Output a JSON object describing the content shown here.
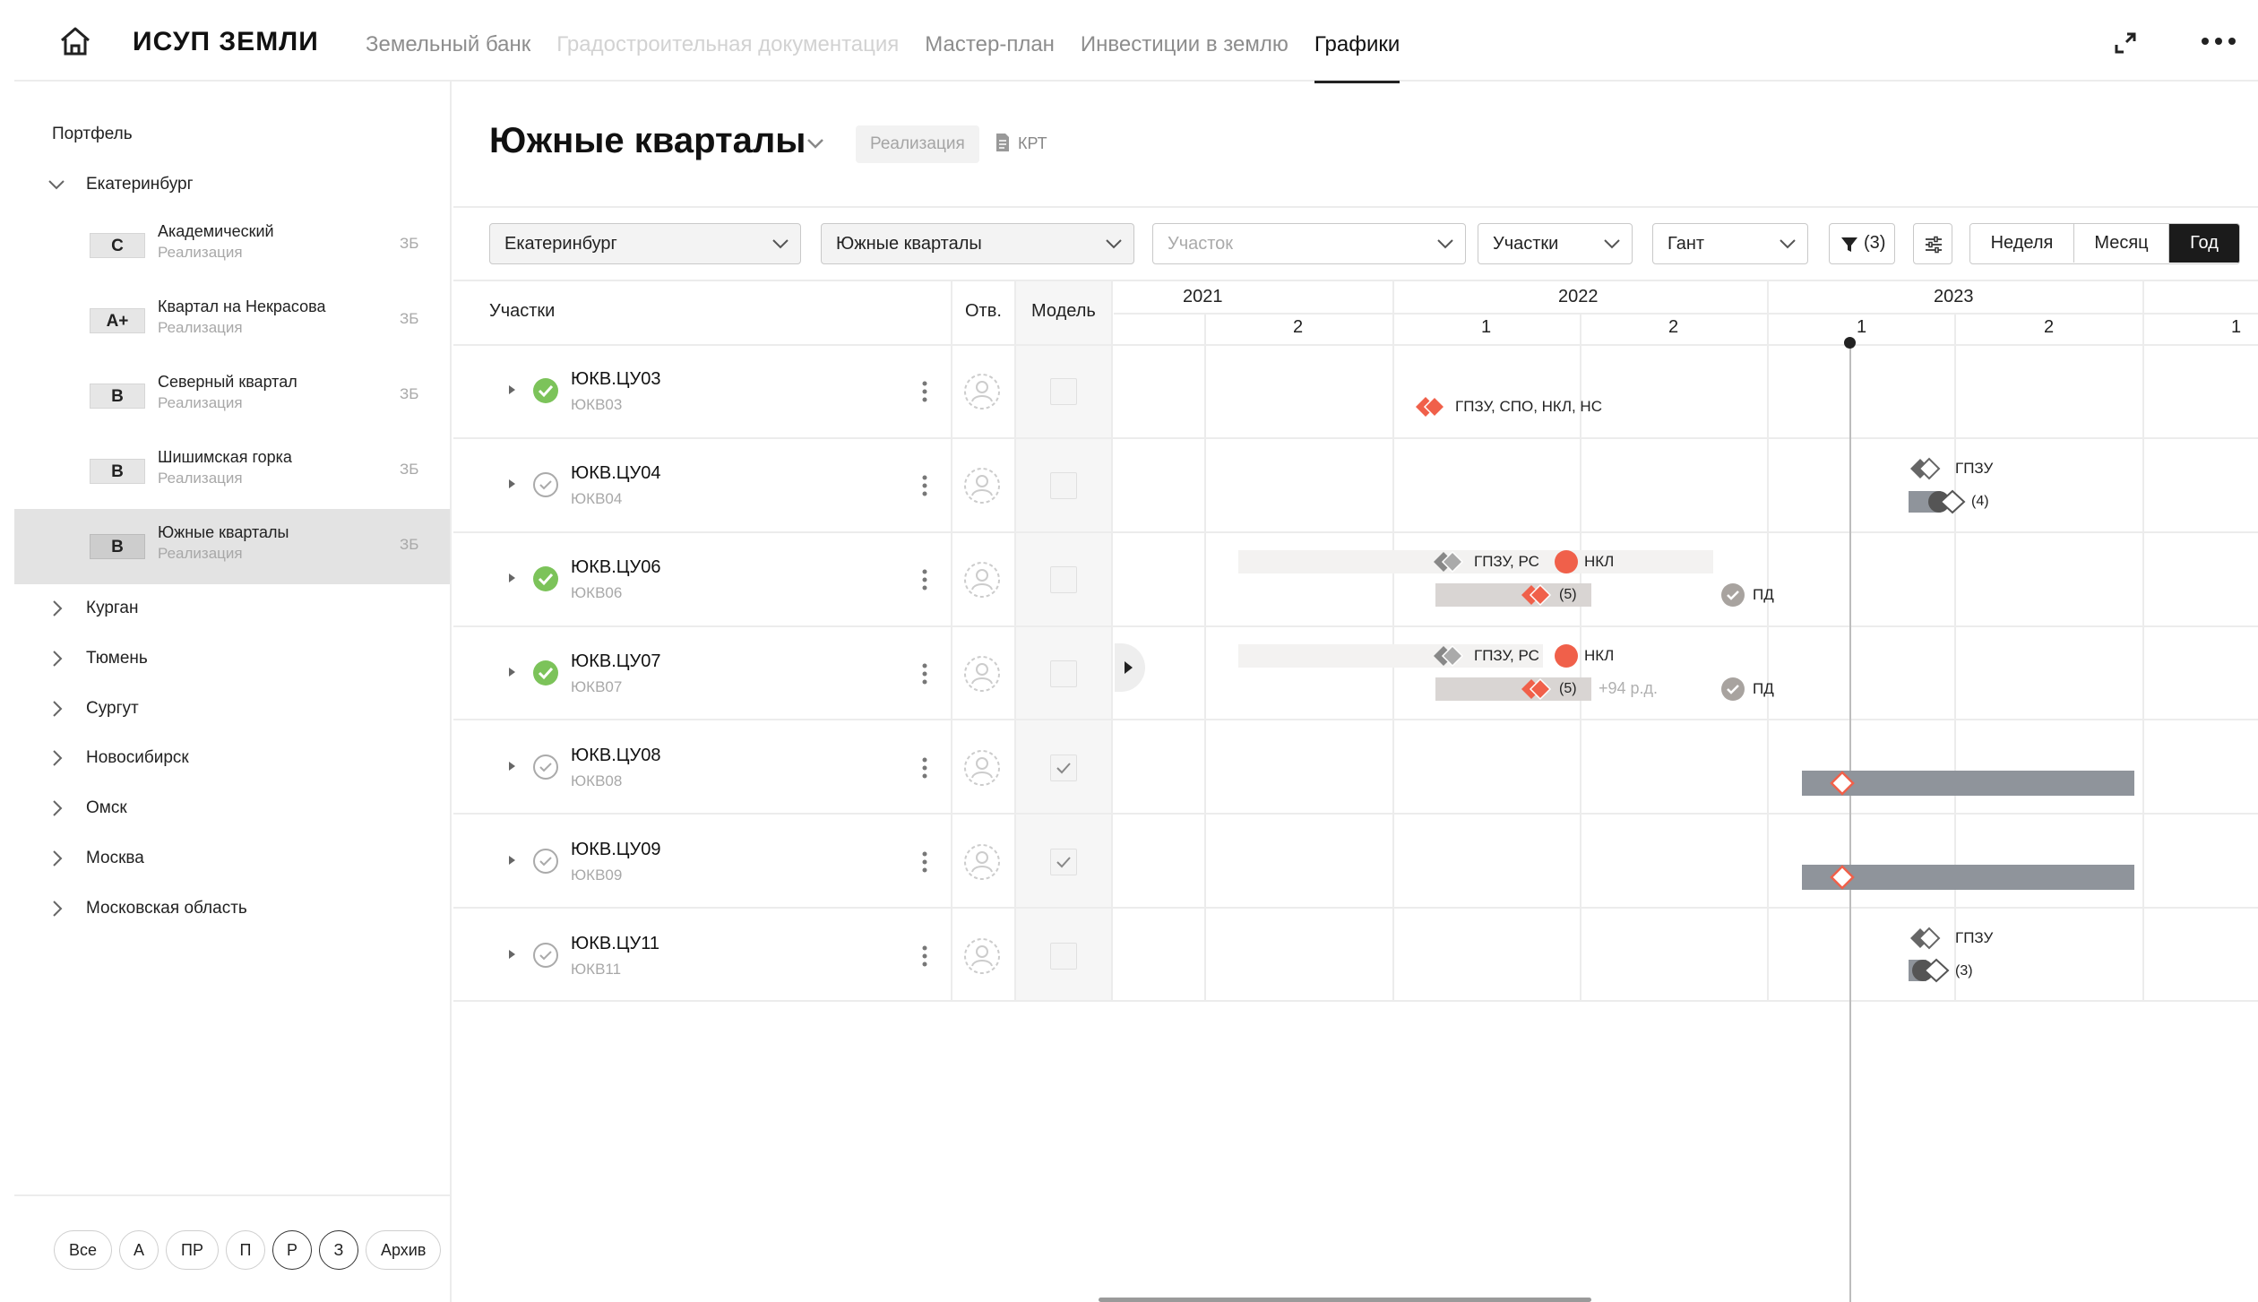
{
  "app": {
    "brand": "ИСУП ЗЕМЛИ",
    "nav": [
      {
        "label": "Земельный банк",
        "state": "normal"
      },
      {
        "label": "Градостроительная документация",
        "state": "disabled"
      },
      {
        "label": "Мастер-план",
        "state": "normal"
      },
      {
        "label": "Инвестиции в землю",
        "state": "normal"
      },
      {
        "label": "Графики",
        "state": "active"
      }
    ],
    "icons": {
      "home": "home-icon",
      "expand": "expand-icon",
      "more": "more-icon"
    }
  },
  "sidebar": {
    "title": "Портфель",
    "expanded_city": "Екатеринбург",
    "projects": [
      {
        "badge": "C",
        "name": "Академический",
        "status": "Реализация",
        "count": "ЗБ"
      },
      {
        "badge": "A+",
        "name": "Квартал на Некрасова",
        "status": "Реализация",
        "count": "ЗБ"
      },
      {
        "badge": "B",
        "name": "Северный квартал",
        "status": "Реализация",
        "count": "ЗБ"
      },
      {
        "badge": "B",
        "name": "Шишимская горка",
        "status": "Реализация",
        "count": "ЗБ"
      },
      {
        "badge": "B",
        "name": "Южные кварталы",
        "status": "Реализация",
        "count": "ЗБ",
        "selected": true
      }
    ],
    "cities": [
      "Курган",
      "Тюмень",
      "Сургут",
      "Новосибирск",
      "Омск",
      "Москва",
      "Московская область"
    ],
    "pills": [
      "Все",
      "А",
      "ПР",
      "П",
      "Р",
      "З",
      "Архив"
    ]
  },
  "header": {
    "title": "Южные кварталы",
    "status": "Реализация",
    "doc_label": "КРТ"
  },
  "toolbar": {
    "city_select": "Екатеринбург",
    "project_select": "Южные кварталы",
    "plot_placeholder": "Участок",
    "group_select": "Участки",
    "view_select": "Гант",
    "filter_count": "(3)",
    "scale_options": [
      "Неделя",
      "Месяц",
      "Год"
    ],
    "scale_active": "Год"
  },
  "table": {
    "headers": {
      "plots": "Участки",
      "resp": "Отв.",
      "model": "Модель"
    },
    "rows": [
      {
        "name": "ЮКВ.ЦУ03",
        "code": "ЮКВ03",
        "status": "done",
        "model_checked": false
      },
      {
        "name": "ЮКВ.ЦУ04",
        "code": "ЮКВ04",
        "status": "pending",
        "model_checked": false
      },
      {
        "name": "ЮКВ.ЦУ06",
        "code": "ЮКВ06",
        "status": "done",
        "model_checked": false
      },
      {
        "name": "ЮКВ.ЦУ07",
        "code": "ЮКВ07",
        "status": "done",
        "model_checked": false
      },
      {
        "name": "ЮКВ.ЦУ08",
        "code": "ЮКВ08",
        "status": "pending",
        "model_checked": true
      },
      {
        "name": "ЮКВ.ЦУ09",
        "code": "ЮКВ09",
        "status": "pending",
        "model_checked": true
      },
      {
        "name": "ЮКВ.ЦУ11",
        "code": "ЮКВ11",
        "status": "pending",
        "model_checked": false
      }
    ]
  },
  "timeline": {
    "years": [
      "2021",
      "2022",
      "2023"
    ],
    "halves": [
      "2",
      "1",
      "2",
      "1",
      "2",
      "1"
    ],
    "labels": {
      "r0_top": "ГПЗУ, СПО, НКЛ, НС",
      "r1_top": "ГПЗУ",
      "r1_bottom": "(4)",
      "r2_top": "ГПЗУ, РС",
      "r2_nkl": "НКЛ",
      "r2_count": "(5)",
      "r2_pd": "ПД",
      "r3_top": "ГПЗУ, РС",
      "r3_nkl": "НКЛ",
      "r3_count": "(5)",
      "r3_delay": "+94 р.д.",
      "r3_pd": "ПД",
      "r6_top": "ГПЗУ",
      "r6_bottom": "(3)"
    },
    "colors": {
      "accent": "#f0604a",
      "bar_grey": "#8f949b",
      "bar_light": "#d9d5d3",
      "success": "#7cc35a"
    }
  }
}
